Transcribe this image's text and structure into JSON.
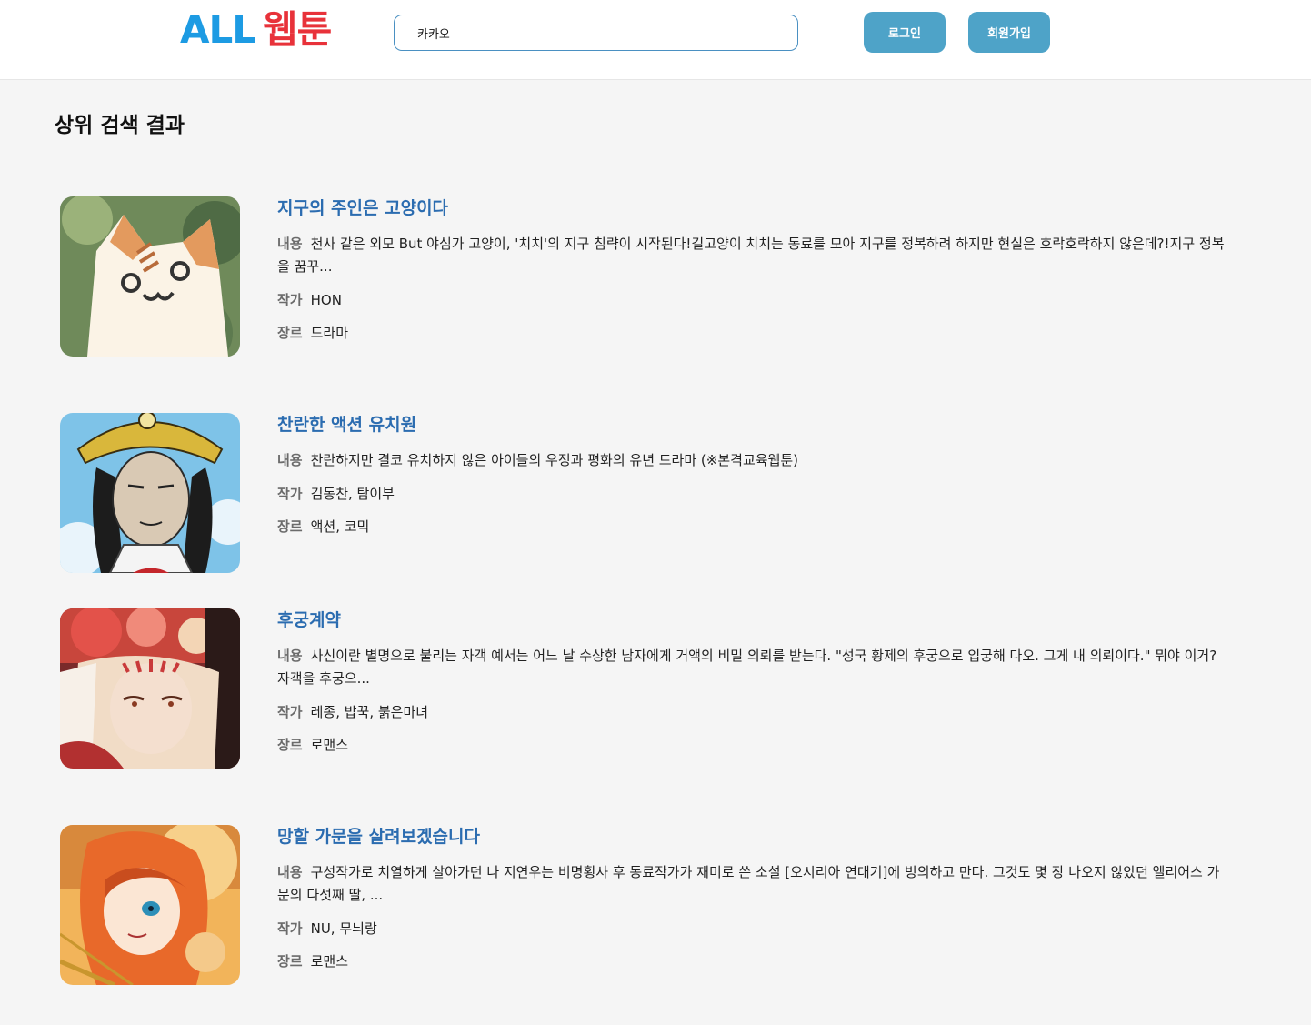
{
  "header": {
    "logo_part1": "ALL",
    "logo_part2": "웹툰",
    "search_value": "카카오",
    "login_label": "로그인",
    "signup_label": "회원가입"
  },
  "main": {
    "section_title": "상위 검색 결과",
    "label_desc": "내용",
    "label_author": "작가",
    "label_genre": "장르",
    "results": [
      {
        "title": "지구의 주인은 고양이다",
        "description": "천사 같은 외모 But 야심가 고양이, '치치'의 지구 침략이 시작된다!길고양이 치치는 동료를 모아 지구를 정복하려 하지만 현실은 호락호락하지 않은데?!지구 정복을 꿈꾸...",
        "author": "HON",
        "genre": "드라마"
      },
      {
        "title": "찬란한 액션 유치원",
        "description": "찬란하지만 결코 유치하지 않은 아이들의 우정과 평화의 유년 드라마 (※본격교육웹툰)",
        "author": "김동찬, 탐이부",
        "genre": "액션, 코믹"
      },
      {
        "title": "후궁계약",
        "description": "사신이란 별명으로 불리는 자객 예서는 어느 날 수상한 남자에게 거액의 비밀 의뢰를 받는다. \"성국 황제의 후궁으로 입궁해 다오. 그게 내 의뢰이다.\" 뭐야 이거? 자객을 후궁으...",
        "author": "레종, 밥꾹, 붉은마녀",
        "genre": "로맨스"
      },
      {
        "title": "망할 가문을 살려보겠습니다",
        "description": "구성작가로 치열하게 살아가던 나 지연우는 비명횡사 후 동료작가가 재미로 쓴 소설 [오시리아 연대기]에 빙의하고 만다. 그것도 몇 장 나오지 않았던 엘리어스 가문의 다섯째 딸, ...",
        "author": "NU, 무늬랑",
        "genre": "로맨스"
      }
    ]
  },
  "colors": {
    "logo_blue": "#1d9be3",
    "logo_red": "#e8323a",
    "button": "#4ea3c8",
    "title_link": "#2b6cb0"
  }
}
